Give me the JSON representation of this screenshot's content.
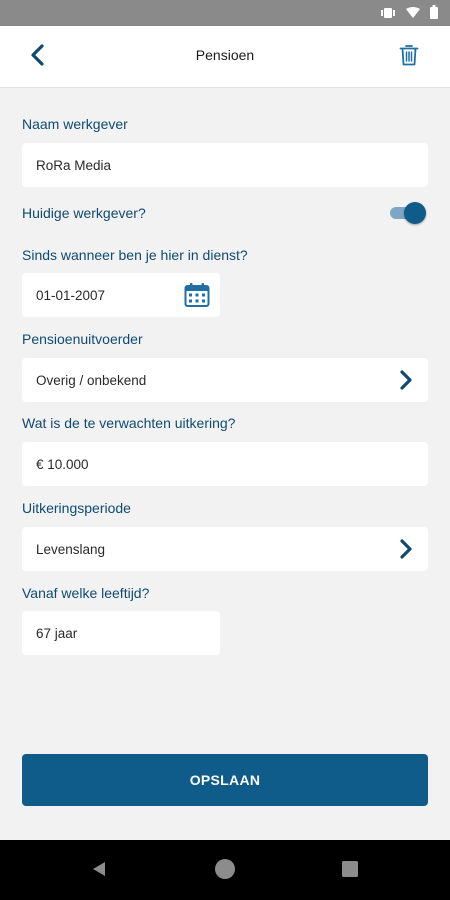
{
  "header": {
    "title": "Pensioen"
  },
  "form": {
    "employer_label": "Naam werkgever",
    "employer_value": "RoRa Media",
    "current_employer_label": "Huidige werkgever?",
    "current_employer_on": true,
    "since_label": "Sinds wanneer ben je hier in dienst?",
    "since_value": "01-01-2007",
    "provider_label": "Pensioenuitvoerder",
    "provider_value": "Overig / onbekend",
    "expected_label": "Wat is de te verwachten uitkering?",
    "expected_value": "€ 10.000",
    "period_label": "Uitkeringsperiode",
    "period_value": "Levenslang",
    "age_label": "Vanaf welke leeftijd?",
    "age_value": "67 jaar"
  },
  "actions": {
    "save_label": "OPSLAAN"
  },
  "colors": {
    "accent": "#0f5b8a",
    "label": "#0f4a73",
    "background": "#f2f2f2"
  }
}
